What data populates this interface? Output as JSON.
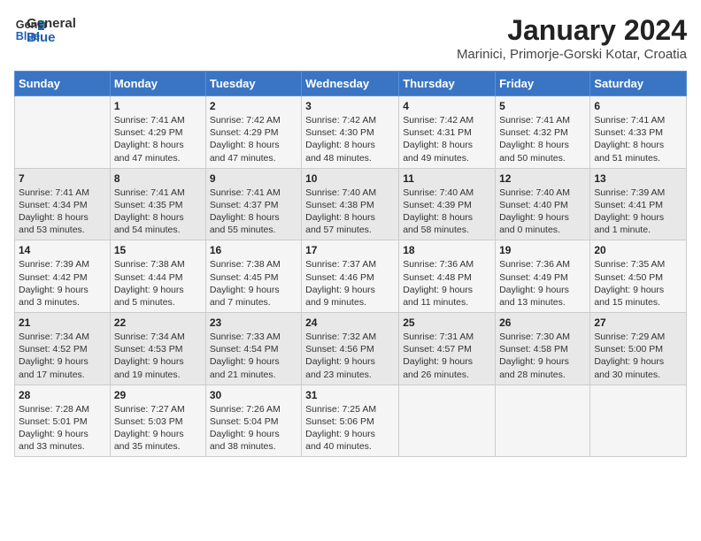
{
  "logo": {
    "line1": "General",
    "line2": "Blue"
  },
  "title": "January 2024",
  "subtitle": "Marinici, Primorje-Gorski Kotar, Croatia",
  "days_of_week": [
    "Sunday",
    "Monday",
    "Tuesday",
    "Wednesday",
    "Thursday",
    "Friday",
    "Saturday"
  ],
  "weeks": [
    [
      {
        "day": "",
        "info": ""
      },
      {
        "day": "1",
        "info": "Sunrise: 7:41 AM\nSunset: 4:29 PM\nDaylight: 8 hours\nand 47 minutes."
      },
      {
        "day": "2",
        "info": "Sunrise: 7:42 AM\nSunset: 4:29 PM\nDaylight: 8 hours\nand 47 minutes."
      },
      {
        "day": "3",
        "info": "Sunrise: 7:42 AM\nSunset: 4:30 PM\nDaylight: 8 hours\nand 48 minutes."
      },
      {
        "day": "4",
        "info": "Sunrise: 7:42 AM\nSunset: 4:31 PM\nDaylight: 8 hours\nand 49 minutes."
      },
      {
        "day": "5",
        "info": "Sunrise: 7:41 AM\nSunset: 4:32 PM\nDaylight: 8 hours\nand 50 minutes."
      },
      {
        "day": "6",
        "info": "Sunrise: 7:41 AM\nSunset: 4:33 PM\nDaylight: 8 hours\nand 51 minutes."
      }
    ],
    [
      {
        "day": "7",
        "info": "Sunrise: 7:41 AM\nSunset: 4:34 PM\nDaylight: 8 hours\nand 53 minutes."
      },
      {
        "day": "8",
        "info": "Sunrise: 7:41 AM\nSunset: 4:35 PM\nDaylight: 8 hours\nand 54 minutes."
      },
      {
        "day": "9",
        "info": "Sunrise: 7:41 AM\nSunset: 4:37 PM\nDaylight: 8 hours\nand 55 minutes."
      },
      {
        "day": "10",
        "info": "Sunrise: 7:40 AM\nSunset: 4:38 PM\nDaylight: 8 hours\nand 57 minutes."
      },
      {
        "day": "11",
        "info": "Sunrise: 7:40 AM\nSunset: 4:39 PM\nDaylight: 8 hours\nand 58 minutes."
      },
      {
        "day": "12",
        "info": "Sunrise: 7:40 AM\nSunset: 4:40 PM\nDaylight: 9 hours\nand 0 minutes."
      },
      {
        "day": "13",
        "info": "Sunrise: 7:39 AM\nSunset: 4:41 PM\nDaylight: 9 hours\nand 1 minute."
      }
    ],
    [
      {
        "day": "14",
        "info": "Sunrise: 7:39 AM\nSunset: 4:42 PM\nDaylight: 9 hours\nand 3 minutes."
      },
      {
        "day": "15",
        "info": "Sunrise: 7:38 AM\nSunset: 4:44 PM\nDaylight: 9 hours\nand 5 minutes."
      },
      {
        "day": "16",
        "info": "Sunrise: 7:38 AM\nSunset: 4:45 PM\nDaylight: 9 hours\nand 7 minutes."
      },
      {
        "day": "17",
        "info": "Sunrise: 7:37 AM\nSunset: 4:46 PM\nDaylight: 9 hours\nand 9 minutes."
      },
      {
        "day": "18",
        "info": "Sunrise: 7:36 AM\nSunset: 4:48 PM\nDaylight: 9 hours\nand 11 minutes."
      },
      {
        "day": "19",
        "info": "Sunrise: 7:36 AM\nSunset: 4:49 PM\nDaylight: 9 hours\nand 13 minutes."
      },
      {
        "day": "20",
        "info": "Sunrise: 7:35 AM\nSunset: 4:50 PM\nDaylight: 9 hours\nand 15 minutes."
      }
    ],
    [
      {
        "day": "21",
        "info": "Sunrise: 7:34 AM\nSunset: 4:52 PM\nDaylight: 9 hours\nand 17 minutes."
      },
      {
        "day": "22",
        "info": "Sunrise: 7:34 AM\nSunset: 4:53 PM\nDaylight: 9 hours\nand 19 minutes."
      },
      {
        "day": "23",
        "info": "Sunrise: 7:33 AM\nSunset: 4:54 PM\nDaylight: 9 hours\nand 21 minutes."
      },
      {
        "day": "24",
        "info": "Sunrise: 7:32 AM\nSunset: 4:56 PM\nDaylight: 9 hours\nand 23 minutes."
      },
      {
        "day": "25",
        "info": "Sunrise: 7:31 AM\nSunset: 4:57 PM\nDaylight: 9 hours\nand 26 minutes."
      },
      {
        "day": "26",
        "info": "Sunrise: 7:30 AM\nSunset: 4:58 PM\nDaylight: 9 hours\nand 28 minutes."
      },
      {
        "day": "27",
        "info": "Sunrise: 7:29 AM\nSunset: 5:00 PM\nDaylight: 9 hours\nand 30 minutes."
      }
    ],
    [
      {
        "day": "28",
        "info": "Sunrise: 7:28 AM\nSunset: 5:01 PM\nDaylight: 9 hours\nand 33 minutes."
      },
      {
        "day": "29",
        "info": "Sunrise: 7:27 AM\nSunset: 5:03 PM\nDaylight: 9 hours\nand 35 minutes."
      },
      {
        "day": "30",
        "info": "Sunrise: 7:26 AM\nSunset: 5:04 PM\nDaylight: 9 hours\nand 38 minutes."
      },
      {
        "day": "31",
        "info": "Sunrise: 7:25 AM\nSunset: 5:06 PM\nDaylight: 9 hours\nand 40 minutes."
      },
      {
        "day": "",
        "info": ""
      },
      {
        "day": "",
        "info": ""
      },
      {
        "day": "",
        "info": ""
      }
    ]
  ]
}
